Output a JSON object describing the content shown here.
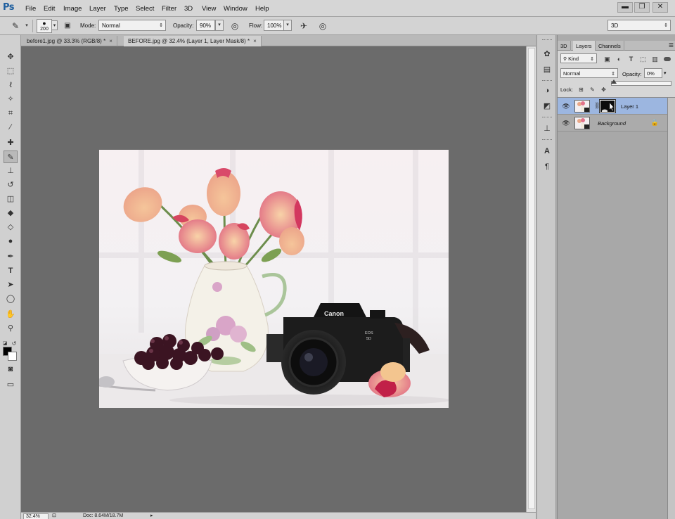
{
  "app": {
    "logo": "Ps"
  },
  "menu": {
    "items": [
      "File",
      "Edit",
      "Image",
      "Layer",
      "Type",
      "Select",
      "Filter",
      "3D",
      "View",
      "Window",
      "Help"
    ]
  },
  "window_controls": {
    "minimize": "▬",
    "restore": "❐",
    "close": "✕"
  },
  "options_bar": {
    "brush_size": "200",
    "mode_label": "Mode:",
    "mode_value": "Normal",
    "opacity_label": "Opacity:",
    "opacity_value": "90%",
    "flow_label": "Flow:",
    "flow_value": "100%",
    "workspace_value": "3D"
  },
  "document_tabs": [
    {
      "label": "before1.jpg @ 33.3% (RGB/8) *",
      "active": false
    },
    {
      "label": "BEFORE.jpg @ 32.4% (Layer 1, Layer Mask/8) *",
      "active": true
    }
  ],
  "status_bar": {
    "zoom": "32.4%",
    "doc_size": "Doc: 8.64M/18.7M"
  },
  "layers_panel": {
    "tabs": [
      "3D",
      "Layers",
      "Channels"
    ],
    "active_tab": "Layers",
    "filter_kind": "Kind",
    "blend_mode": "Normal",
    "opacity_label": "Opacity:",
    "opacity_value": "0%",
    "lock_label": "Lock:",
    "layers": [
      {
        "name": "Layer 1",
        "selected": true,
        "has_mask": true,
        "locked": false
      },
      {
        "name": "Background",
        "selected": false,
        "has_mask": false,
        "locked": true
      }
    ]
  },
  "colors": {
    "foreground": "#000000",
    "background": "#ffffff",
    "canvas_bg": "#6b6b6b",
    "selection": "#9cb6e0"
  }
}
